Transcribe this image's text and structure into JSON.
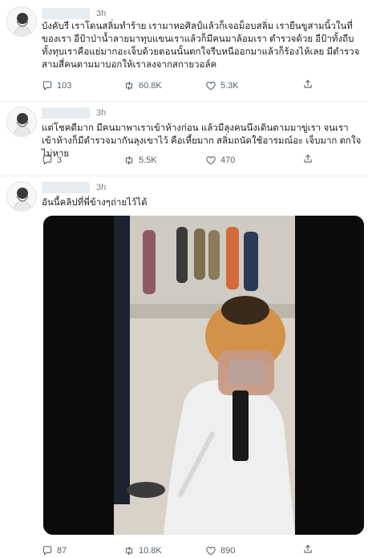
{
  "tweets": [
    {
      "time": "3h",
      "text": "บังคับรี เราโดนสลิ่มทำร้าย เรามาหอศิลป์แล้วก็เจอม็อบสลิ่ม เรายืนขูสามนิ้วในที่ของเรา อีป้าป่าน้ำลายมาทุบแขนเราแล้วก็มีคนมาล้อมเรา ตำรวจด้วย อีป้าทั้งถีบทั้งทุบเราคือแย่มากอะเจ็บด้วยตอนนั้นตกใจรีบหนีออกมาแล้วก็ร้องไห้เลย มีตำรวจสามสี่คนตามมาบอกให้เราลงจากสกายวอล์ค",
      "replies": "103",
      "retweets": "60.8K",
      "likes": "5.3K"
    },
    {
      "time": "3h",
      "text": "แต่โชคดีมาก มีคนมาพาเราเข้าห้างก่อน แล้วมีลุงคนนึงเดินตามมาขู่เรา จนเราเข้าห้างก็มีตำรวจมากันลุงเขาไว้ คือเหี้ยมาก สลิ่มถนัดใช้อารมณ์อะ เจ็บมาก ตกใจไม่หาย",
      "replies": "3",
      "retweets": "5.5K",
      "likes": "470"
    },
    {
      "time": "3h",
      "text": "อันนี้คลิปที่พี่ข้างๆถ่ายไว้ได้",
      "replies": "87",
      "retweets": "10.8K",
      "likes": "890"
    }
  ],
  "icons": {
    "reply": "reply-icon",
    "retweet": "retweet-icon",
    "like": "like-icon",
    "share": "share-icon",
    "avatar": "avatar-image"
  },
  "colors": {
    "icon": "#56626b",
    "thread_line": "#cfd9de",
    "redaction": "#e6ecf0"
  }
}
